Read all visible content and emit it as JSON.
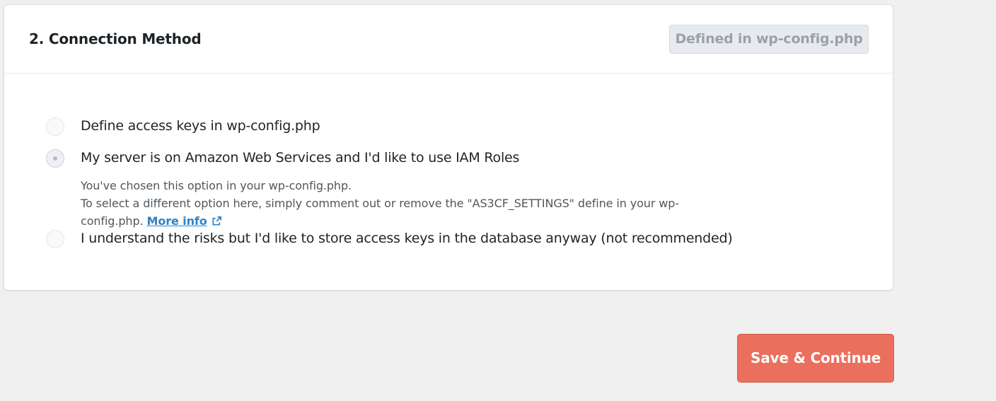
{
  "panel": {
    "title": "2. Connection Method",
    "defined_badge": "Defined in wp-config.php"
  },
  "options": [
    {
      "label": "Define access keys in wp-config.php",
      "checked": false
    },
    {
      "label": "My server is on Amazon Web Services and I'd like to use IAM Roles",
      "checked": true
    },
    {
      "label": "I understand the risks but I'd like to store access keys in the database anyway (not recommended)",
      "checked": false
    }
  ],
  "notice": {
    "line1": "You've chosen this option in your wp-config.php.",
    "line2": "To select a different option here, simply comment out or remove the \"AS3CF_SETTINGS\" define in your wp-",
    "line3": "config.php.",
    "link_text": "More info",
    "link_icon": "external-link-icon"
  },
  "footer": {
    "save_label": "Save & Continue"
  },
  "colors": {
    "accent_button": "#ea6f5c",
    "link": "#2e83c5",
    "badge_text": "#9aa1a9"
  }
}
